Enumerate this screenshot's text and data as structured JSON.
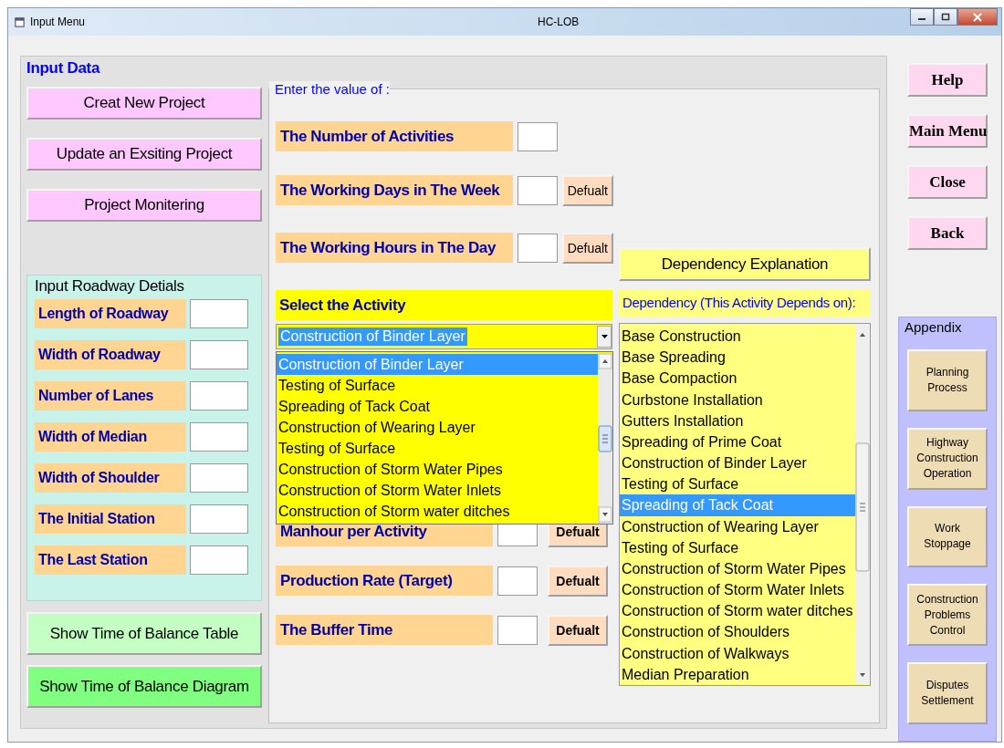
{
  "window": {
    "title": "Input Menu",
    "app_title": "HC-LOB"
  },
  "input_data": {
    "title": "Input Data",
    "project_buttons": [
      "Creat New Project",
      "Update an Exsiting Project",
      "Project Monitering"
    ],
    "roadway": {
      "title": "Input Roadway Detials",
      "fields": [
        {
          "label": "Length of Roadway"
        },
        {
          "label": "Width of Roadway"
        },
        {
          "label": "Number of Lanes"
        },
        {
          "label": "Width of Median"
        },
        {
          "label": "Width of Shoulder"
        },
        {
          "label": "The Initial Station"
        },
        {
          "label": "The Last Station"
        }
      ]
    },
    "show_buttons": [
      {
        "label": "Show Time of Balance Table",
        "kind": "table"
      },
      {
        "label": "Show Time of Balance Diagram",
        "kind": "diagram"
      }
    ],
    "values": {
      "title": "Enter the value of :",
      "top_fields": [
        {
          "label": "The Number of Activities"
        },
        {
          "label": "The Working Days in The Week",
          "default_button": "Defualt"
        },
        {
          "label": "The Working Hours in The Day",
          "default_button": "Defualt"
        }
      ],
      "activity": {
        "title": "Select the Activity",
        "value": "Construction of Binder Layer",
        "expanded": true,
        "options": [
          {
            "label": "Construction of Binder Layer",
            "selected": true
          },
          {
            "label": "Testing of Surface",
            "selected": false
          },
          {
            "label": "Spreading of Tack Coat",
            "selected": false
          },
          {
            "label": "Construction of Wearing Layer",
            "selected": false
          },
          {
            "label": "Testing of Surface",
            "selected": false
          },
          {
            "label": "Construction of Storm Water Pipes",
            "selected": false
          },
          {
            "label": "Construction of Storm Water Inlets",
            "selected": false
          },
          {
            "label": "Construction of Storm water ditches",
            "selected": false
          }
        ]
      },
      "lower_fields": [
        {
          "label": "Manhour per Activity",
          "default_button": "Defualt"
        },
        {
          "label": "Production Rate (Target)",
          "default_button": "Defualt"
        },
        {
          "label": "The Buffer Time",
          "default_button": "Defualt"
        }
      ],
      "dependency": {
        "button": "Dependency Explanation",
        "title": "Dependency (This Activity Depends on):",
        "items": [
          {
            "label": "Base Construction",
            "selected": false
          },
          {
            "label": "Base Spreading",
            "selected": false
          },
          {
            "label": "Base Compaction",
            "selected": false
          },
          {
            "label": "Curbstone Installation",
            "selected": false
          },
          {
            "label": "Gutters Installation",
            "selected": false
          },
          {
            "label": "Spreading of Prime Coat",
            "selected": false
          },
          {
            "label": "Construction of Binder Layer",
            "selected": false
          },
          {
            "label": "Testing of Surface",
            "selected": false
          },
          {
            "label": "Spreading of Tack Coat",
            "selected": true
          },
          {
            "label": "Construction of Wearing Layer",
            "selected": false
          },
          {
            "label": "Testing of Surface",
            "selected": false
          },
          {
            "label": "Construction of Storm Water Pipes",
            "selected": false
          },
          {
            "label": "Construction of Storm Water Inlets",
            "selected": false
          },
          {
            "label": "Construction of Storm water ditches",
            "selected": false
          },
          {
            "label": "Construction of Shoulders",
            "selected": false
          },
          {
            "label": "Construction of Walkways",
            "selected": false
          },
          {
            "label": "Median Preparation",
            "selected": false
          }
        ]
      }
    }
  },
  "side_buttons": [
    "Help",
    "Main Menu",
    "Close",
    "Back"
  ],
  "appendix": {
    "title": "Appendix",
    "buttons": [
      "Planning Process",
      "Highway Construction Operation",
      "Work Stoppage",
      "Construction Problems Control",
      "Disputes Settlement"
    ]
  }
}
